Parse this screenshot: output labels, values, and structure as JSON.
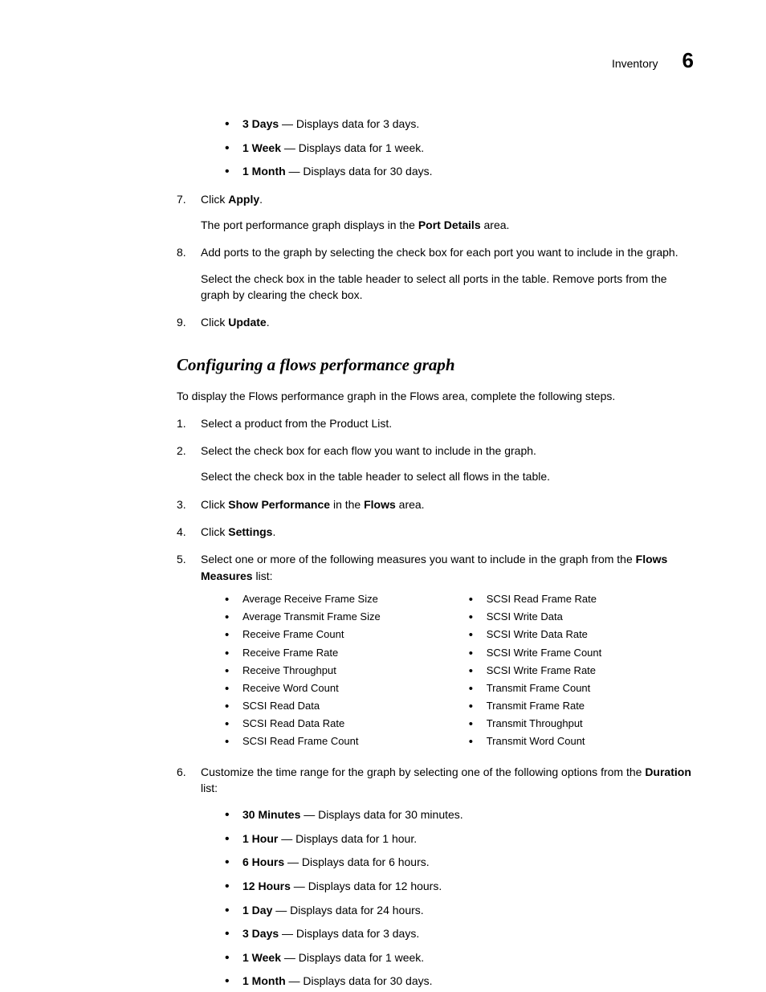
{
  "header": {
    "title": "Inventory",
    "chapter": "6"
  },
  "topBullets": [
    {
      "bold": "3 Days",
      "rest": " — Displays data for 3 days."
    },
    {
      "bold": "1 Week",
      "rest": " — Displays data for 1 week."
    },
    {
      "bold": "1 Month",
      "rest": " — Displays data for 30 days."
    }
  ],
  "steps1": {
    "s7": {
      "num": "7.",
      "pre": "Click ",
      "bold": "Apply",
      "post": "."
    },
    "s7b": {
      "pre": "The port performance graph displays in the ",
      "bold": "Port Details",
      "post": " area."
    },
    "s8": {
      "num": "8.",
      "text": "Add ports to the graph by selecting the check box for each port you want to include in the graph."
    },
    "s8b": "Select the check box in the table header to select all ports in the table. Remove ports from the graph by clearing the check box.",
    "s9": {
      "num": "9.",
      "pre": "Click ",
      "bold": "Update",
      "post": "."
    }
  },
  "sectionTitle": "Configuring a flows performance graph",
  "intro": "To display the Flows performance graph in the Flows area, complete the following steps.",
  "steps2": {
    "s1": {
      "num": "1.",
      "text": "Select a product from the Product List."
    },
    "s2": {
      "num": "2.",
      "text": "Select the check box for each flow you want to include in the graph."
    },
    "s2b": "Select the check box in the table header to select all flows in the table.",
    "s3": {
      "num": "3.",
      "pre": "Click ",
      "bold1": "Show Performance",
      "mid": " in the ",
      "bold2": "Flows",
      "post": " area."
    },
    "s4": {
      "num": "4.",
      "pre": "Click ",
      "bold": "Settings",
      "post": "."
    },
    "s5": {
      "num": "5.",
      "pre": "Select one or more of the following measures you want to include in the graph from the ",
      "bold": "Flows Measures",
      "post": " list:"
    },
    "s6": {
      "num": "6.",
      "pre": "Customize the time range for the graph by selecting one of the following options from the ",
      "bold": "Duration",
      "post": " list:"
    }
  },
  "measuresLeft": [
    "Average Receive Frame Size",
    "Average Transmit Frame Size",
    "Receive Frame Count",
    "Receive Frame Rate",
    "Receive Throughput",
    "Receive Word Count",
    "SCSI Read Data",
    "SCSI Read Data Rate",
    "SCSI Read Frame Count"
  ],
  "measuresRight": [
    "SCSI Read Frame Rate",
    "SCSI Write Data",
    "SCSI Write Data Rate",
    "SCSI Write Frame Count",
    "SCSI Write Frame Rate",
    "Transmit Frame Count",
    "Transmit Frame Rate",
    "Transmit Throughput",
    "Transmit Word Count"
  ],
  "durations": [
    {
      "bold": "30 Minutes",
      "rest": " — Displays data for 30 minutes."
    },
    {
      "bold": "1 Hour",
      "rest": " — Displays data for 1 hour."
    },
    {
      "bold": "6 Hours",
      "rest": " — Displays data for 6 hours."
    },
    {
      "bold": "12 Hours",
      "rest": " — Displays data for 12 hours."
    },
    {
      "bold": "1 Day",
      "rest": " — Displays data for 24 hours."
    },
    {
      "bold": "3 Days",
      "rest": " — Displays data for 3 days."
    },
    {
      "bold": "1 Week",
      "rest": " — Displays data for 1 week."
    },
    {
      "bold": "1 Month",
      "rest": " — Displays data for 30 days."
    }
  ]
}
